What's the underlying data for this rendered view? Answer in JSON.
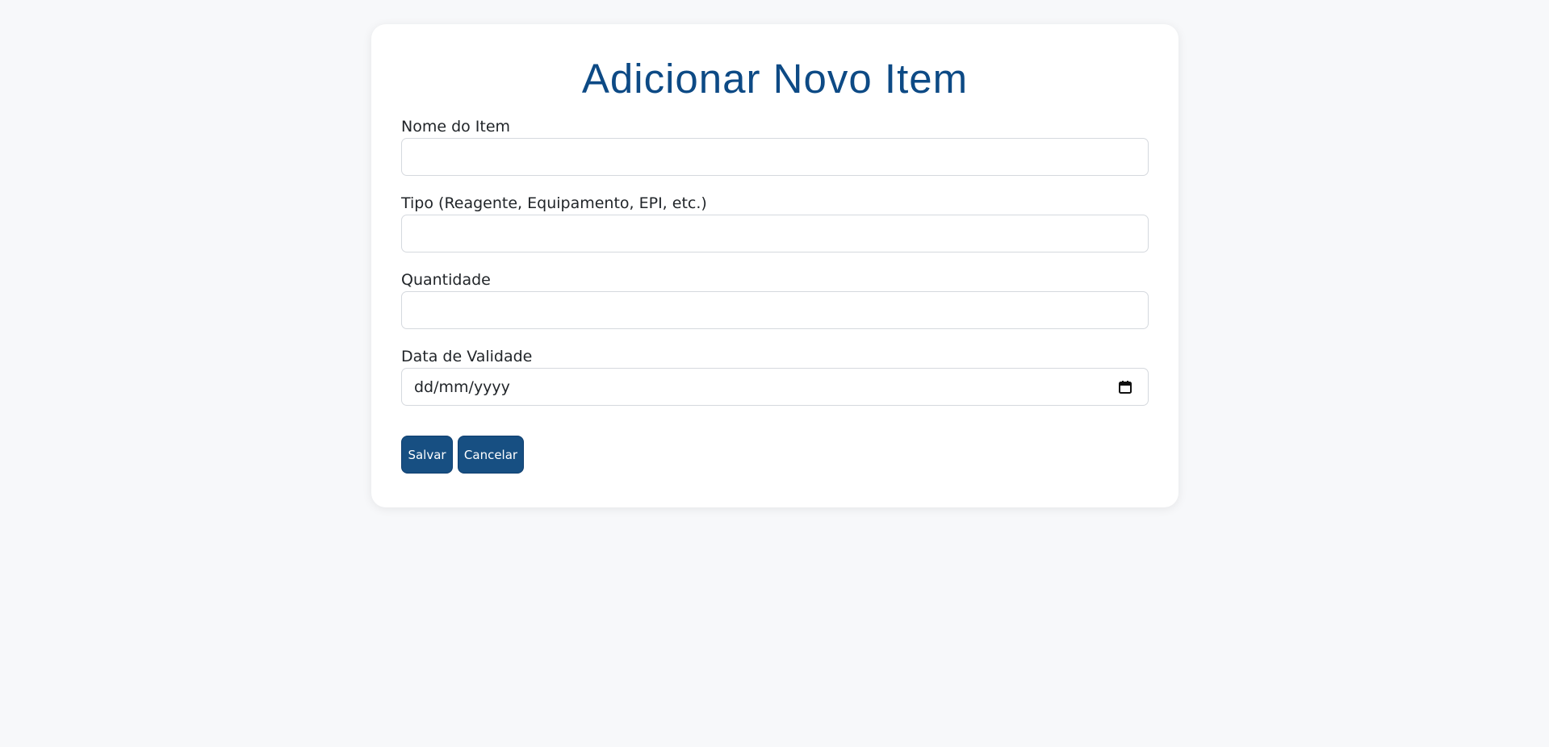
{
  "form": {
    "title": "Adicionar Novo Item",
    "fields": [
      {
        "label": "Nome do Item",
        "value": "",
        "placeholder": ""
      },
      {
        "label": "Tipo (Reagente, Equipamento, EPI, etc.)",
        "value": "",
        "placeholder": ""
      },
      {
        "label": "Quantidade",
        "value": "",
        "placeholder": ""
      },
      {
        "label": "Data de Validade",
        "value": "",
        "placeholder": "dd/mm/yyyy",
        "icon": "calendar-icon"
      }
    ],
    "buttons": {
      "save_label": "Salvar",
      "cancel_label": "Cancelar"
    }
  },
  "colors": {
    "background": "#f7f8fa",
    "card": "#ffffff",
    "title": "#0d4a85",
    "button": "#174f82",
    "button_text": "#ffffff",
    "input_border": "#d5d9de"
  }
}
